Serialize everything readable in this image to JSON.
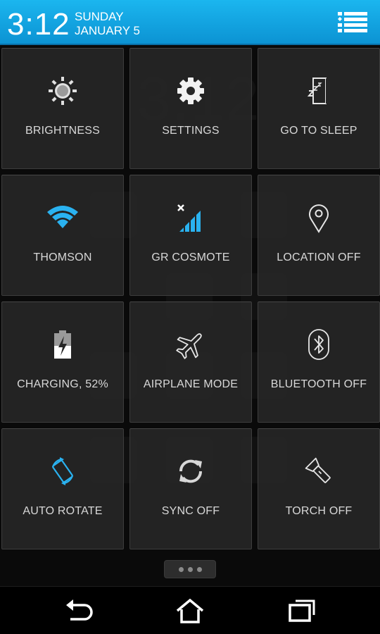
{
  "header": {
    "time": "3:12",
    "day": "SUNDAY",
    "date": "JANUARY 5",
    "list_icon": "notification-list-icon",
    "bg_color": "#1aa9e6"
  },
  "tiles": [
    {
      "label": "BRIGHTNESS",
      "icon": "brightness-icon",
      "active": false
    },
    {
      "label": "SETTINGS",
      "icon": "gear-icon",
      "active": false
    },
    {
      "label": "GO TO SLEEP",
      "icon": "sleep-icon",
      "active": false
    },
    {
      "label": "THOMSON",
      "icon": "wifi-icon",
      "active": true
    },
    {
      "label": "GR COSMOTE",
      "icon": "cellular-signal-icon",
      "active": true
    },
    {
      "label": "LOCATION OFF",
      "icon": "location-pin-icon",
      "active": false
    },
    {
      "label": "CHARGING, 52%",
      "icon": "battery-charging-icon",
      "active": false
    },
    {
      "label": "AIRPLANE MODE",
      "icon": "airplane-icon",
      "active": false
    },
    {
      "label": "BLUETOOTH OFF",
      "icon": "bluetooth-icon",
      "active": false
    },
    {
      "label": "AUTO ROTATE",
      "icon": "auto-rotate-icon",
      "active": true
    },
    {
      "label": "SYNC OFF",
      "icon": "sync-icon",
      "active": false
    },
    {
      "label": "TORCH OFF",
      "icon": "flashlight-icon",
      "active": false
    }
  ],
  "colors": {
    "accent": "#2ab2f0",
    "tile_bg": "#262626",
    "label": "#d8d8d8"
  },
  "navbar": {
    "back_icon": "back-icon",
    "home_icon": "home-icon",
    "recents_icon": "recent-apps-icon"
  }
}
